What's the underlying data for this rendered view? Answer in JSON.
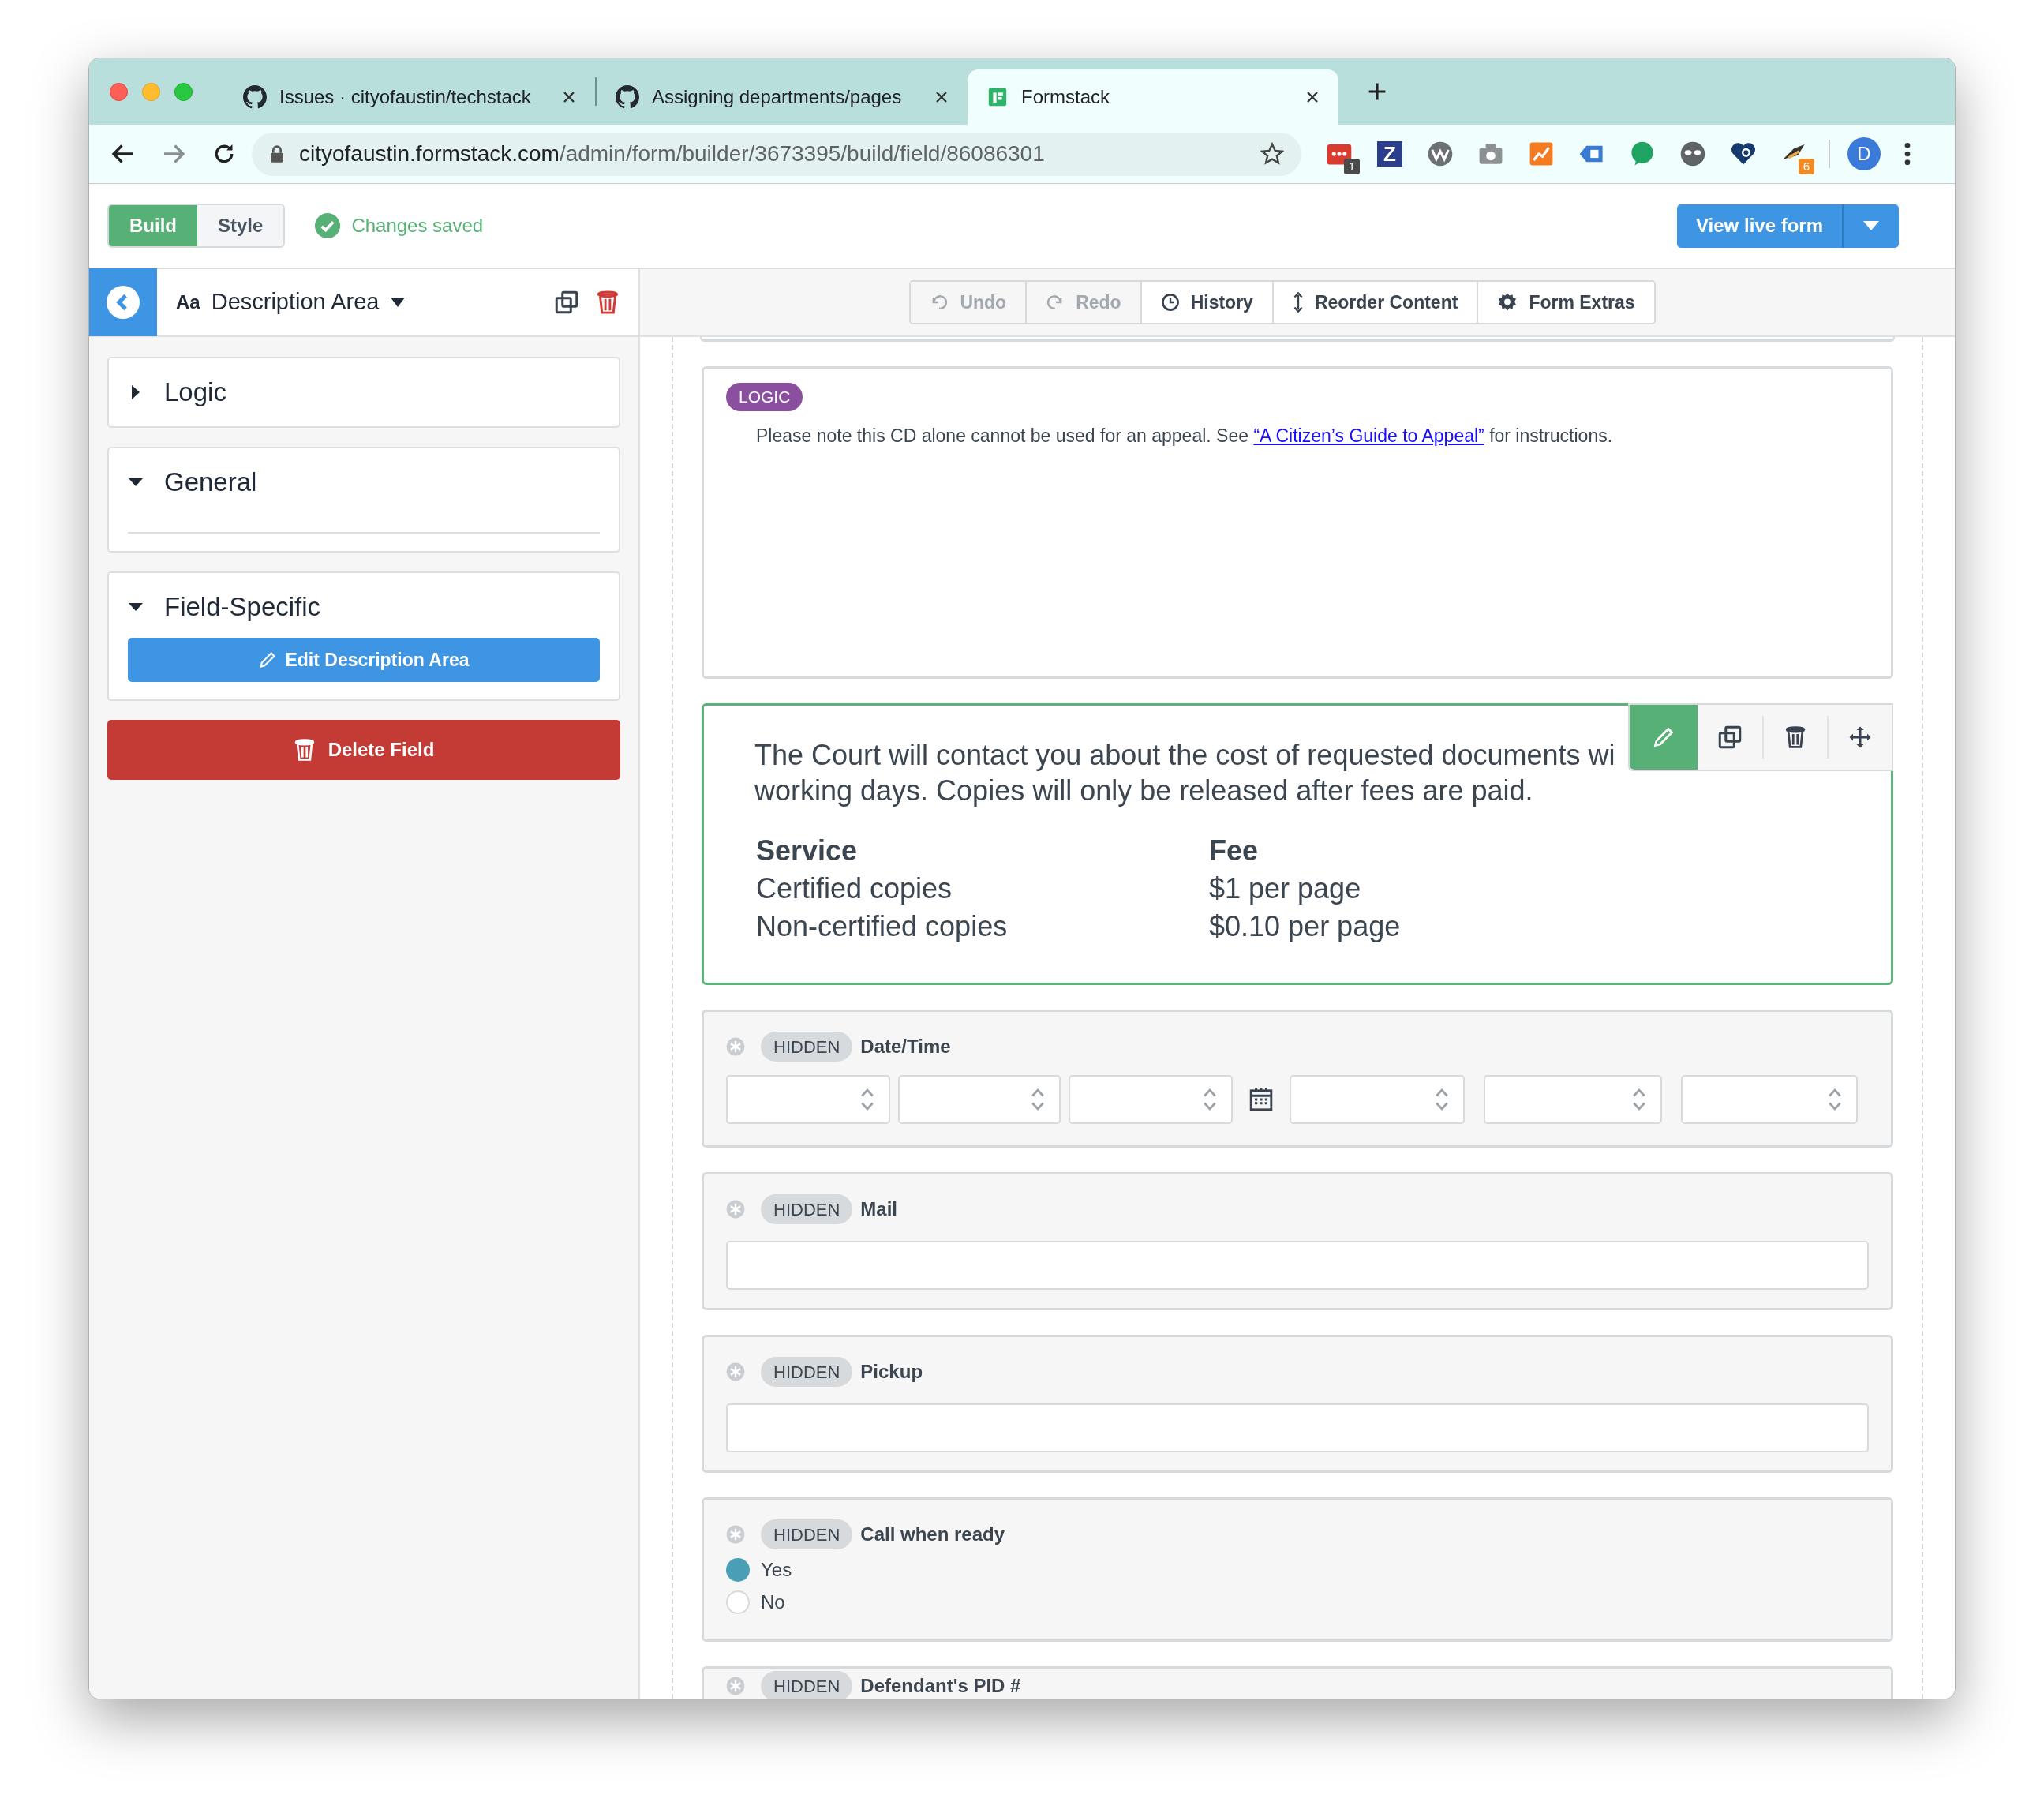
{
  "browser": {
    "tabs": [
      {
        "title": "Issues · cityofaustin/techstack",
        "selected": false,
        "kind": "github"
      },
      {
        "title": "Assigning departments/pages",
        "selected": false,
        "kind": "github"
      },
      {
        "title": "Formstack",
        "selected": true,
        "kind": "formstack"
      }
    ],
    "url_host": "cityofaustin.formstack.com",
    "url_path": "/admin/form/builder/3673395/build/field/86086301",
    "extensions": [
      {
        "kind": "calendar",
        "badge": "1"
      },
      {
        "kind": "letter",
        "glyph": "Z"
      },
      {
        "kind": "wave"
      },
      {
        "kind": "camera"
      },
      {
        "kind": "chart"
      },
      {
        "kind": "tag"
      },
      {
        "kind": "bubble"
      },
      {
        "kind": "mask"
      },
      {
        "kind": "heart"
      },
      {
        "kind": "bird",
        "badge": "6"
      }
    ],
    "profile": "D"
  },
  "builder": {
    "modes": [
      {
        "label": "Build",
        "selected": true
      },
      {
        "label": "Style",
        "selected": false
      }
    ],
    "status": "Changes saved",
    "view_button": "View live form"
  },
  "sidebar": {
    "field_prefix": "Aa",
    "field_type": "Description Area",
    "sections": [
      {
        "title": "Logic",
        "expanded": false
      },
      {
        "title": "General",
        "expanded": true
      },
      {
        "title": "Field-Specific",
        "expanded": true,
        "button": "Edit Description Area"
      }
    ],
    "delete_button": "Delete Field"
  },
  "toolbar": [
    {
      "kind": "undo",
      "label": "Undo",
      "disabled": true
    },
    {
      "kind": "redo",
      "label": "Redo",
      "disabled": true
    },
    {
      "kind": "history",
      "label": "History",
      "disabled": false
    },
    {
      "kind": "reorder",
      "label": "Reorder Content",
      "disabled": false
    },
    {
      "kind": "gear",
      "label": "Form Extras",
      "disabled": false
    }
  ],
  "fields": [
    {
      "kind": "description",
      "selected": false,
      "badge": "LOGIC",
      "text_before": "Please note this CD alone cannot be used for an appeal. See ",
      "link": "“A Citizen’s Guide to Appeal”",
      "text_after": " for instructions."
    },
    {
      "kind": "fee_description",
      "selected": true,
      "lines": [
        "The Court will contact you about the cost of requested documents wi",
        "working days. Copies will only be released after fees are paid."
      ],
      "table": {
        "columns": [
          "Service",
          "Fee"
        ],
        "rows": [
          [
            "Certified copies",
            "$1 per page"
          ],
          [
            "Non-certified copies",
            "$0.10 per page"
          ]
        ]
      }
    },
    {
      "kind": "datetime",
      "badge": "HIDDEN",
      "label": "Date/Time"
    },
    {
      "kind": "text",
      "badge": "HIDDEN",
      "label": "Mail"
    },
    {
      "kind": "text",
      "badge": "HIDDEN",
      "label": "Pickup"
    },
    {
      "kind": "radio",
      "badge": "HIDDEN",
      "label": "Call when ready",
      "options": [
        {
          "label": "Yes",
          "selected": true
        },
        {
          "label": "No",
          "selected": false
        }
      ]
    },
    {
      "kind": "cut",
      "badge": "HIDDEN",
      "label": "Defendant's PID #"
    }
  ]
}
